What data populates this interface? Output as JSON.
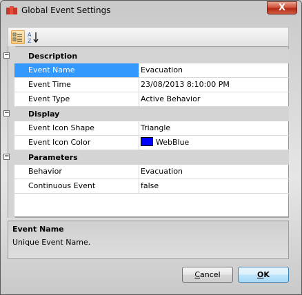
{
  "window": {
    "title": "Global Event Settings",
    "close_label": "X"
  },
  "toolbar": {
    "categorized_icon": "categorized-icon",
    "alphabetical_icon": "alphabetical-sort-icon"
  },
  "grid": {
    "categories": [
      {
        "label": "Description",
        "expander": "−",
        "properties": [
          {
            "name": "Event Name",
            "value": "Evacuation"
          },
          {
            "name": "Event Time",
            "value": "23/08/2013 8:10:00 PM"
          },
          {
            "name": "Event Type",
            "value": "Active Behavior"
          }
        ]
      },
      {
        "label": "Display",
        "expander": "−",
        "properties": [
          {
            "name": "Event Icon Shape",
            "value": "Triangle"
          },
          {
            "name": "Event Icon Color",
            "value": "WebBlue",
            "swatch": "#0000FF"
          }
        ]
      },
      {
        "label": "Parameters",
        "expander": "−",
        "properties": [
          {
            "name": "Behavior",
            "value": "Evacuation"
          },
          {
            "name": "Continuous Event",
            "value": "false"
          }
        ]
      }
    ],
    "selected_property": "Event Name"
  },
  "description": {
    "title": "Event Name",
    "text": "Unique Event Name."
  },
  "buttons": {
    "cancel": {
      "first": "C",
      "rest": "ancel"
    },
    "ok": {
      "first": "O",
      "rest": "K"
    }
  },
  "colors": {
    "selection": "#3399FF",
    "category_bg": "#D4D4D4",
    "swatch": "#0000FF"
  }
}
